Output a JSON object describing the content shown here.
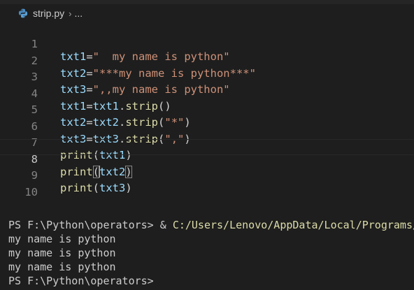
{
  "breadcrumb": {
    "file_name": "strip.py",
    "separator": "›",
    "ellipsis": "..."
  },
  "editor": {
    "current_line": 8,
    "lines": [
      {
        "number": "1",
        "text": "txt1=\"  my name is python\""
      },
      {
        "number": "2",
        "text": "txt2=\"***my name is python***\""
      },
      {
        "number": "3",
        "text": "txt3=\",,my name is python\""
      },
      {
        "number": "4",
        "text": "txt1=txt1.strip()"
      },
      {
        "number": "5",
        "text": "txt2=txt2.strip(\"*\")"
      },
      {
        "number": "6",
        "text": "txt3=txt3.strip(\",\")"
      },
      {
        "number": "7",
        "text": "print(txt1)"
      },
      {
        "number": "8",
        "text": "print(txt2)"
      },
      {
        "number": "9",
        "text": "print(txt3)"
      },
      {
        "number": "10",
        "text": ""
      }
    ]
  },
  "terminal": {
    "prompt": "PS F:\\Python\\operators>",
    "call_operator": "&",
    "command": "C:/Users/Lenovo/AppData/Local/Programs/",
    "outputs": [
      "my name is python",
      "my name is python",
      "my name is python"
    ]
  },
  "colors": {
    "background": "#1e1e1e",
    "variable": "#9cdcfe",
    "string": "#ce9178",
    "function": "#dcdcaa",
    "line_number": "#858585",
    "python_icon": "#4b8bbe"
  }
}
